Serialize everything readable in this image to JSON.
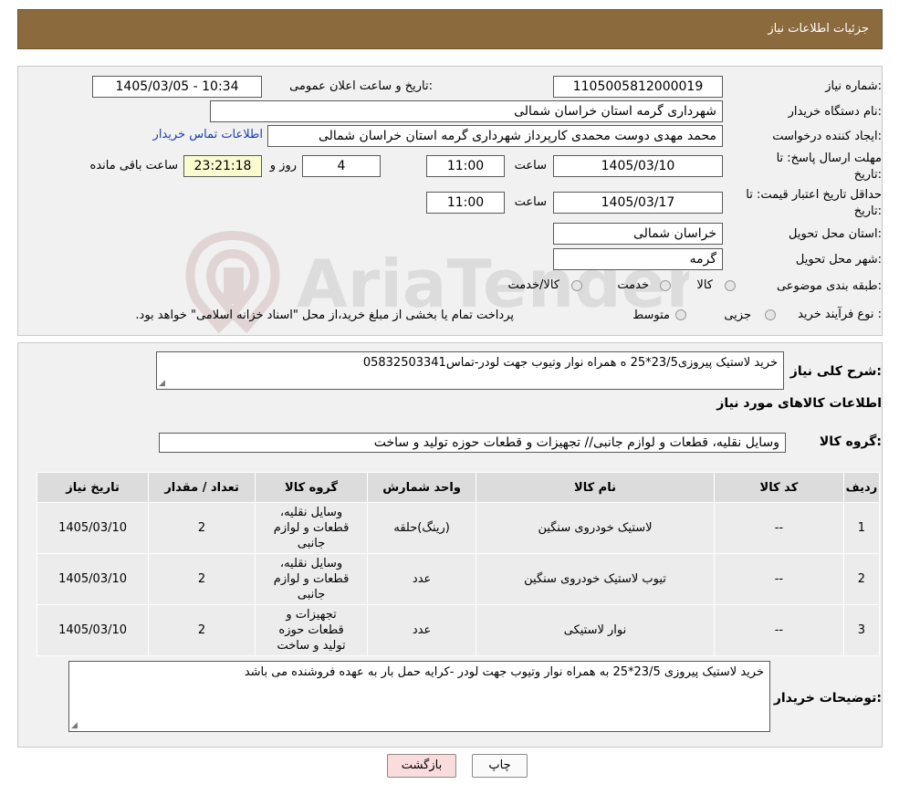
{
  "header": {
    "title": "جزئیات اطلاعات نیاز"
  },
  "need_number": {
    "label": "شماره نیاز:",
    "value": "1105005812000019"
  },
  "announce": {
    "label": "تاریخ و ساعت اعلان عمومی:",
    "value": "1405/03/05 - 10:34"
  },
  "buyer_org": {
    "label": "نام دستگاه خریدار:",
    "value": "شهرداری گرمه استان خراسان شمالی"
  },
  "requester": {
    "label": "ایجاد کننده درخواست:",
    "value": "محمد مهدی دوست محمدی کارپرداز شهرداری گرمه استان خراسان شمالی",
    "contact_link": "اطلاعات تماس خریدار"
  },
  "response_deadline": {
    "label_line1": "مهلت ارسال پاسخ: تا",
    "label_line2": "تاریخ:",
    "date": "1405/03/10",
    "time_label": "ساعت",
    "time": "11:00",
    "days": "4",
    "days_label": "روز و",
    "remaining": "23:21:18",
    "remaining_label": "ساعت باقی مانده"
  },
  "price_validity": {
    "label_line1": "حداقل تاریخ اعتبار قیمت: تا",
    "label_line2": "تاریخ:",
    "date": "1405/03/17",
    "time_label": "ساعت",
    "time": "11:00"
  },
  "province": {
    "label": "استان محل تحویل:",
    "value": "خراسان شمالی"
  },
  "city": {
    "label": "شهر محل تحویل:",
    "value": "گرمه"
  },
  "category": {
    "label": "طبقه بندی موضوعی:",
    "options": [
      "کالا",
      "خدمت",
      "کالا/خدمت"
    ]
  },
  "process": {
    "label": "نوع فرآیند خرید :",
    "options": [
      "جزیی",
      "متوسط"
    ],
    "note": "پرداخت تمام یا بخشی از مبلغ خرید،از محل \"اسناد خزانه اسلامی\" خواهد بود."
  },
  "description": {
    "label": "شرح کلی نیاز:",
    "value": "خرید لاستیک پیروزی23/5*25 ه همراه نوار وتیوب جهت لودر-تماس05832503341"
  },
  "goods_section": {
    "title": "اطلاعات کالاهای مورد نیاز"
  },
  "goods_group": {
    "label": "گروه کالا:",
    "value": "وسایل نقلیه، قطعات و لوازم جانبی// تجهیزات و قطعات حوزه تولید و ساخت"
  },
  "table": {
    "headers": [
      "ردیف",
      "کد کالا",
      "نام کالا",
      "واحد شمارش",
      "گروه کالا",
      "تعداد / مقدار",
      "تاریخ نیاز"
    ],
    "rows": [
      [
        "1",
        "--",
        "لاستیک خودروی سنگین",
        "(رینگ)حلقه",
        "وسایل نقلیه، قطعات و لوازم جانبی",
        "2",
        "1405/03/10"
      ],
      [
        "2",
        "--",
        "تیوب لاستیک خودروی سنگین",
        "عدد",
        "وسایل نقلیه، قطعات و لوازم جانبی",
        "2",
        "1405/03/10"
      ],
      [
        "3",
        "--",
        "نوار لاستیکی",
        "عدد",
        "تجهیزات و قطعات حوزه تولید و ساخت",
        "2",
        "1405/03/10"
      ]
    ]
  },
  "buyer_notes": {
    "label": "توضیحات خریدار:",
    "value": "خرید لاستیک پیروزی 23/5*25 به همراه نوار وتیوب جهت لودر -کرایه حمل بار به عهده فروشنده می باشد"
  },
  "buttons": {
    "print": "چاپ",
    "back": "بازگشت"
  },
  "watermark": {
    "text": "AriaTender.neT"
  },
  "colors": {
    "header_bg": "#8b6a3e",
    "link": "#1a3fb0",
    "remaining_bg": "#fbfbd0",
    "back_btn_bg": "#fadcdc"
  }
}
